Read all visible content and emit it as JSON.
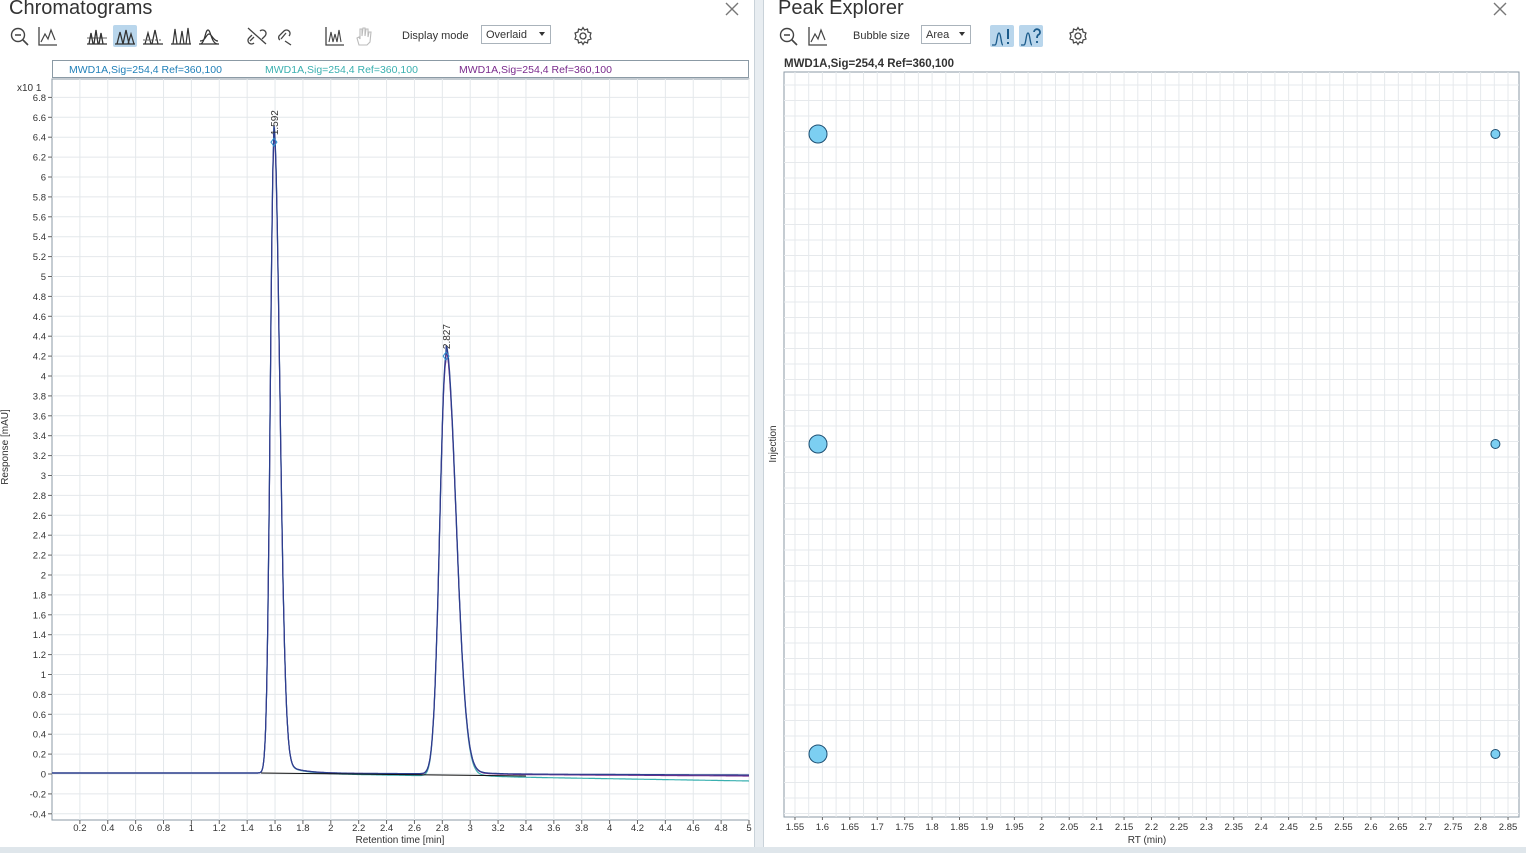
{
  "chromatograms": {
    "title": "Chromatograms",
    "display_mode_label": "Display mode",
    "display_mode_value": "Overlaid",
    "legend": [
      {
        "label": "MWD1A,Sig=254,4 Ref=360,100",
        "color": "#1f7fb8"
      },
      {
        "label": "MWD1A,Sig=254,4 Ref=360,100",
        "color": "#3ab0b0"
      },
      {
        "label": "MWD1A,Sig=254,4 Ref=360,100",
        "color": "#7a2a8c"
      }
    ],
    "chart_data": {
      "type": "line",
      "xlabel": "Retention time [min]",
      "ylabel": "Response [mAU]",
      "y_multiplier": "x10 1",
      "xlim": [
        0,
        5
      ],
      "ylim": [
        -0.4,
        6.9
      ],
      "x_ticks": [
        "0.2",
        "0.4",
        "0.6",
        "0.8",
        "1",
        "1.2",
        "1.4",
        "1.6",
        "1.8",
        "2",
        "2.2",
        "2.4",
        "2.6",
        "2.8",
        "3",
        "3.2",
        "3.4",
        "3.6",
        "3.8",
        "4",
        "4.2",
        "4.4",
        "4.6",
        "4.8",
        "5"
      ],
      "y_ticks": [
        "6.8",
        "6.6",
        "6.4",
        "6.2",
        "6",
        "5.8",
        "5.6",
        "5.4",
        "5.2",
        "5",
        "4.8",
        "4.6",
        "4.4",
        "4.2",
        "4",
        "3.8",
        "3.6",
        "3.4",
        "3.2",
        "3",
        "2.8",
        "2.6",
        "2.4",
        "2.2",
        "2",
        "1.8",
        "1.6",
        "1.4",
        "1.2",
        "1",
        "0.8",
        "0.6",
        "0.4",
        "0.2",
        "0",
        "-0.2",
        "-0.4"
      ],
      "peaks": [
        {
          "label": "1.592",
          "x": 1.592,
          "y": 6.35
        },
        {
          "label": "2.827",
          "x": 2.827,
          "y": 4.2
        }
      ],
      "series": [
        {
          "color": "#2a3f8f",
          "peaks": [
            [
              1.592,
              6.35,
              0.026
            ],
            [
              2.827,
              4.2,
              0.045
            ]
          ],
          "baseline_end": -0.02
        },
        {
          "color": "#3ab0b0",
          "peaks": [
            [
              1.592,
              6.33,
              0.026
            ],
            [
              2.827,
              4.18,
              0.045
            ]
          ],
          "baseline_end": -0.08
        },
        {
          "color": "#7a2a8c",
          "peaks": [
            [
              1.592,
              6.3,
              0.026
            ],
            [
              2.827,
              4.15,
              0.045
            ]
          ],
          "baseline_end": -0.03
        }
      ]
    }
  },
  "peak_explorer": {
    "title": "Peak Explorer",
    "bubble_size_label": "Bubble size",
    "bubble_size_value": "Area",
    "chart_data": {
      "type": "scatter",
      "title": "MWD1A,Sig=254,4  Ref=360,100",
      "xlabel": "RT (min)",
      "ylabel": "Injection",
      "xlim": [
        1.53,
        2.87
      ],
      "x_ticks": [
        "1.55",
        "1.6",
        "1.65",
        "1.7",
        "1.75",
        "1.8",
        "1.85",
        "1.9",
        "1.95",
        "2",
        "2.05",
        "2.1",
        "2.15",
        "2.2",
        "2.25",
        "2.3",
        "2.35",
        "2.4",
        "2.45",
        "2.5",
        "2.55",
        "2.6",
        "2.65",
        "2.7",
        "2.75",
        "2.8",
        "2.85"
      ],
      "points": [
        {
          "x": 1.592,
          "injection": 1,
          "size": "large"
        },
        {
          "x": 2.827,
          "injection": 1,
          "size": "small"
        },
        {
          "x": 1.592,
          "injection": 2,
          "size": "large"
        },
        {
          "x": 2.827,
          "injection": 2,
          "size": "small"
        },
        {
          "x": 1.592,
          "injection": 3,
          "size": "large"
        },
        {
          "x": 2.827,
          "injection": 3,
          "size": "small"
        }
      ],
      "bubble_color": "#7ccff2"
    }
  }
}
